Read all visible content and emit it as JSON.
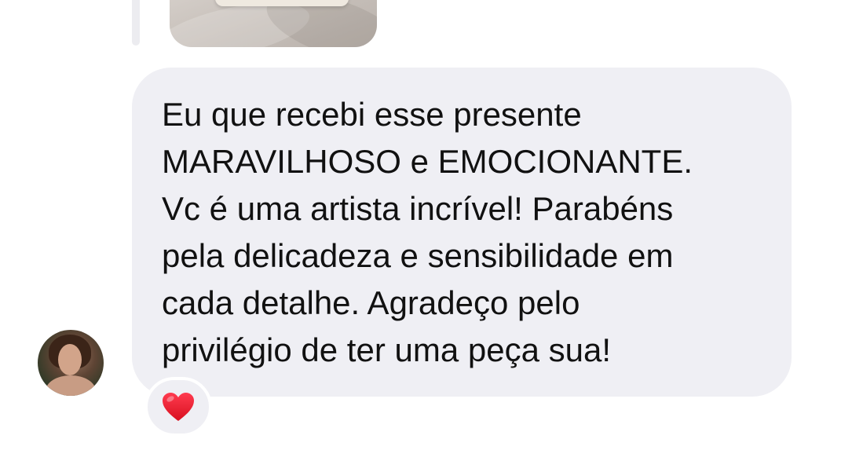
{
  "reply_preview": {
    "icon": "photo-thumbnail"
  },
  "message": {
    "lines": [
      "Eu que recebi esse presente",
      "MARAVILHOSO e EMOCIONANTE.",
      "Vc é uma artista incrível! Parabéns",
      "pela delicadeza e sensibilidade em",
      "cada detalhe. Agradeço pelo",
      "privilégio de ter uma peça sua!"
    ],
    "bubble_color": "#efeff4",
    "text_color": "#111111"
  },
  "sender": {
    "avatar_icon": "avatar-photo"
  },
  "reaction": {
    "icon": "red-heart-icon",
    "color": "#e8192c"
  }
}
